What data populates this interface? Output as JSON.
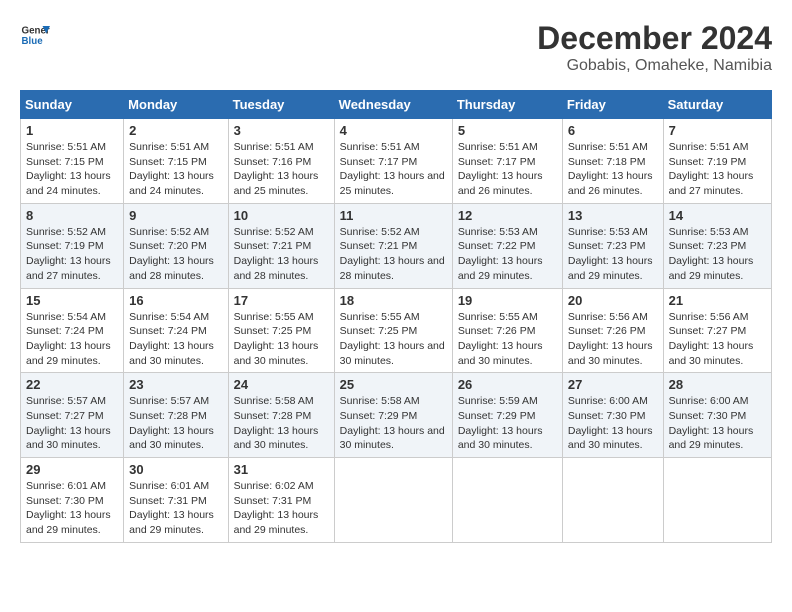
{
  "logo": {
    "line1": "General",
    "line2": "Blue"
  },
  "title": "December 2024",
  "subtitle": "Gobabis, Omaheke, Namibia",
  "days_of_week": [
    "Sunday",
    "Monday",
    "Tuesday",
    "Wednesday",
    "Thursday",
    "Friday",
    "Saturday"
  ],
  "weeks": [
    [
      {
        "day": "1",
        "sunrise": "5:51 AM",
        "sunset": "7:15 PM",
        "daylight": "13 hours and 24 minutes."
      },
      {
        "day": "2",
        "sunrise": "5:51 AM",
        "sunset": "7:15 PM",
        "daylight": "13 hours and 24 minutes."
      },
      {
        "day": "3",
        "sunrise": "5:51 AM",
        "sunset": "7:16 PM",
        "daylight": "13 hours and 25 minutes."
      },
      {
        "day": "4",
        "sunrise": "5:51 AM",
        "sunset": "7:17 PM",
        "daylight": "13 hours and 25 minutes."
      },
      {
        "day": "5",
        "sunrise": "5:51 AM",
        "sunset": "7:17 PM",
        "daylight": "13 hours and 26 minutes."
      },
      {
        "day": "6",
        "sunrise": "5:51 AM",
        "sunset": "7:18 PM",
        "daylight": "13 hours and 26 minutes."
      },
      {
        "day": "7",
        "sunrise": "5:51 AM",
        "sunset": "7:19 PM",
        "daylight": "13 hours and 27 minutes."
      }
    ],
    [
      {
        "day": "8",
        "sunrise": "5:52 AM",
        "sunset": "7:19 PM",
        "daylight": "13 hours and 27 minutes."
      },
      {
        "day": "9",
        "sunrise": "5:52 AM",
        "sunset": "7:20 PM",
        "daylight": "13 hours and 28 minutes."
      },
      {
        "day": "10",
        "sunrise": "5:52 AM",
        "sunset": "7:21 PM",
        "daylight": "13 hours and 28 minutes."
      },
      {
        "day": "11",
        "sunrise": "5:52 AM",
        "sunset": "7:21 PM",
        "daylight": "13 hours and 28 minutes."
      },
      {
        "day": "12",
        "sunrise": "5:53 AM",
        "sunset": "7:22 PM",
        "daylight": "13 hours and 29 minutes."
      },
      {
        "day": "13",
        "sunrise": "5:53 AM",
        "sunset": "7:23 PM",
        "daylight": "13 hours and 29 minutes."
      },
      {
        "day": "14",
        "sunrise": "5:53 AM",
        "sunset": "7:23 PM",
        "daylight": "13 hours and 29 minutes."
      }
    ],
    [
      {
        "day": "15",
        "sunrise": "5:54 AM",
        "sunset": "7:24 PM",
        "daylight": "13 hours and 29 minutes."
      },
      {
        "day": "16",
        "sunrise": "5:54 AM",
        "sunset": "7:24 PM",
        "daylight": "13 hours and 30 minutes."
      },
      {
        "day": "17",
        "sunrise": "5:55 AM",
        "sunset": "7:25 PM",
        "daylight": "13 hours and 30 minutes."
      },
      {
        "day": "18",
        "sunrise": "5:55 AM",
        "sunset": "7:25 PM",
        "daylight": "13 hours and 30 minutes."
      },
      {
        "day": "19",
        "sunrise": "5:55 AM",
        "sunset": "7:26 PM",
        "daylight": "13 hours and 30 minutes."
      },
      {
        "day": "20",
        "sunrise": "5:56 AM",
        "sunset": "7:26 PM",
        "daylight": "13 hours and 30 minutes."
      },
      {
        "day": "21",
        "sunrise": "5:56 AM",
        "sunset": "7:27 PM",
        "daylight": "13 hours and 30 minutes."
      }
    ],
    [
      {
        "day": "22",
        "sunrise": "5:57 AM",
        "sunset": "7:27 PM",
        "daylight": "13 hours and 30 minutes."
      },
      {
        "day": "23",
        "sunrise": "5:57 AM",
        "sunset": "7:28 PM",
        "daylight": "13 hours and 30 minutes."
      },
      {
        "day": "24",
        "sunrise": "5:58 AM",
        "sunset": "7:28 PM",
        "daylight": "13 hours and 30 minutes."
      },
      {
        "day": "25",
        "sunrise": "5:58 AM",
        "sunset": "7:29 PM",
        "daylight": "13 hours and 30 minutes."
      },
      {
        "day": "26",
        "sunrise": "5:59 AM",
        "sunset": "7:29 PM",
        "daylight": "13 hours and 30 minutes."
      },
      {
        "day": "27",
        "sunrise": "6:00 AM",
        "sunset": "7:30 PM",
        "daylight": "13 hours and 30 minutes."
      },
      {
        "day": "28",
        "sunrise": "6:00 AM",
        "sunset": "7:30 PM",
        "daylight": "13 hours and 29 minutes."
      }
    ],
    [
      {
        "day": "29",
        "sunrise": "6:01 AM",
        "sunset": "7:30 PM",
        "daylight": "13 hours and 29 minutes."
      },
      {
        "day": "30",
        "sunrise": "6:01 AM",
        "sunset": "7:31 PM",
        "daylight": "13 hours and 29 minutes."
      },
      {
        "day": "31",
        "sunrise": "6:02 AM",
        "sunset": "7:31 PM",
        "daylight": "13 hours and 29 minutes."
      },
      null,
      null,
      null,
      null
    ]
  ]
}
